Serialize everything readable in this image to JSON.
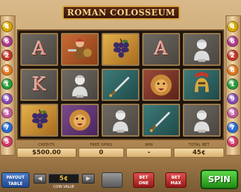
{
  "game": {
    "title": "ROMAN COLOSSEUM"
  },
  "lines": {
    "left": [
      {
        "label": "4",
        "color": "#d8a800"
      },
      {
        "label": "6",
        "color": "#b03a8a"
      },
      {
        "label": "2",
        "color": "#c0392b"
      },
      {
        "label": "8",
        "color": "#e07a20"
      },
      {
        "label": "1",
        "color": "#2a9a3a"
      },
      {
        "label": "9",
        "color": "#8a4ab0"
      },
      {
        "label": "3",
        "color": "#c05a9a"
      },
      {
        "label": "7",
        "color": "#2a6ad0"
      },
      {
        "label": "5",
        "color": "#d03a6a"
      }
    ],
    "right": [
      {
        "label": "4",
        "color": "#d8a800"
      },
      {
        "label": "6",
        "color": "#b03a8a"
      },
      {
        "label": "2",
        "color": "#c0392b"
      },
      {
        "label": "8",
        "color": "#e07a20"
      },
      {
        "label": "1",
        "color": "#2a9a3a"
      },
      {
        "label": "9",
        "color": "#8a4ab0"
      },
      {
        "label": "3",
        "color": "#c05a9a"
      },
      {
        "label": "7",
        "color": "#2a6ad0"
      },
      {
        "label": "5",
        "color": "#d03a6a"
      }
    ]
  },
  "reels": [
    [
      {
        "symbol": "A",
        "bg": "stone"
      },
      {
        "symbol": "gladiator",
        "bg": "orange"
      },
      {
        "symbol": "grapes",
        "bg": "gold"
      },
      {
        "symbol": "A",
        "bg": "stone"
      },
      {
        "symbol": "bust",
        "bg": "stone"
      }
    ],
    [
      {
        "symbol": "K",
        "bg": "stone"
      },
      {
        "symbol": "bust",
        "bg": "stone"
      },
      {
        "symbol": "dagger",
        "bg": "teal"
      },
      {
        "symbol": "lion",
        "bg": "red"
      },
      {
        "symbol": "helmet",
        "bg": "teal"
      }
    ],
    [
      {
        "symbol": "grapes",
        "bg": "gold"
      },
      {
        "symbol": "lion",
        "bg": "purple"
      },
      {
        "symbol": "bust",
        "bg": "stone"
      },
      {
        "symbol": "dagger",
        "bg": "teal"
      },
      {
        "symbol": "bust",
        "bg": "stone"
      }
    ]
  ],
  "stats": {
    "credits_label": "CREDITS",
    "credits_value": "$500.00",
    "free_spins_label": "FREE SPINS",
    "free_spins_value": "0",
    "win_label": "WIN",
    "win_value": "-",
    "total_bet_label": "TOTAL BET",
    "total_bet_value": "45¢"
  },
  "controls": {
    "payout_label": "PAYOUT TABLE",
    "coin_value": "5¢",
    "coin_value_label": "COIN VALUE",
    "left_arrow": "◀",
    "right_arrow": "▶",
    "bet_one_label": "BET ONE",
    "bet_max_label": "BET MAX",
    "spin_label": "SPIN"
  }
}
